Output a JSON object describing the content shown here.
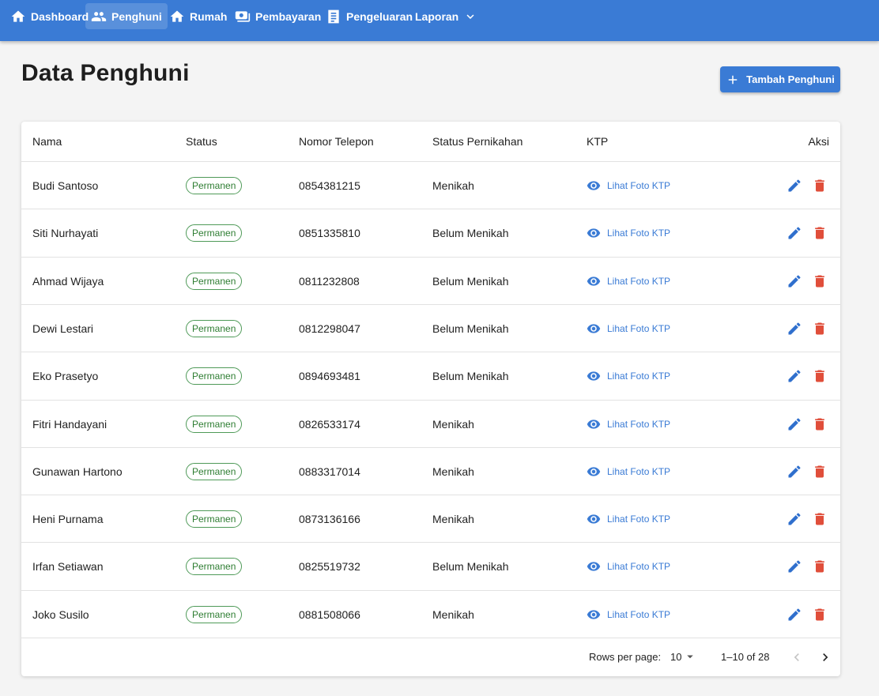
{
  "nav": {
    "items": [
      {
        "label": "Dashboard",
        "icon": "home-icon"
      },
      {
        "label": "Penghuni",
        "icon": "people-icon",
        "active": true
      },
      {
        "label": "Rumah",
        "icon": "home-icon"
      },
      {
        "label": "Pembayaran",
        "icon": "payments-icon"
      },
      {
        "label": "Pengeluaran",
        "icon": "receipt-icon"
      },
      {
        "label": "Laporan",
        "icon": "chevron-down-icon"
      }
    ]
  },
  "page": {
    "title": "Data Penghuni",
    "add_button": "Tambah Penghuni"
  },
  "table": {
    "headers": {
      "name": "Nama",
      "status": "Status",
      "phone": "Nomor Telepon",
      "marital": "Status Pernikahan",
      "ktp": "KTP",
      "actions": "Aksi"
    },
    "ktp_link_label": "Lihat Foto KTP",
    "rows": [
      {
        "name": "Budi Santoso",
        "status": "Permanen",
        "phone": "0854381215",
        "marital": "Menikah"
      },
      {
        "name": "Siti Nurhayati",
        "status": "Permanen",
        "phone": "0851335810",
        "marital": "Belum Menikah"
      },
      {
        "name": "Ahmad Wijaya",
        "status": "Permanen",
        "phone": "0811232808",
        "marital": "Belum Menikah"
      },
      {
        "name": "Dewi Lestari",
        "status": "Permanen",
        "phone": "0812298047",
        "marital": "Belum Menikah"
      },
      {
        "name": "Eko Prasetyo",
        "status": "Permanen",
        "phone": "0894693481",
        "marital": "Belum Menikah"
      },
      {
        "name": "Fitri Handayani",
        "status": "Permanen",
        "phone": "0826533174",
        "marital": "Menikah"
      },
      {
        "name": "Gunawan Hartono",
        "status": "Permanen",
        "phone": "0883317014",
        "marital": "Menikah"
      },
      {
        "name": "Heni Purnama",
        "status": "Permanen",
        "phone": "0873136166",
        "marital": "Menikah"
      },
      {
        "name": "Irfan Setiawan",
        "status": "Permanen",
        "phone": "0825519732",
        "marital": "Belum Menikah"
      },
      {
        "name": "Joko Susilo",
        "status": "Permanen",
        "phone": "0881508066",
        "marital": "Menikah"
      }
    ]
  },
  "pagination": {
    "rows_per_page_label": "Rows per page:",
    "rows_per_page_value": "10",
    "range": "1–10 of 28"
  },
  "colors": {
    "primary": "#3a7bd5",
    "chip_green": "#2e7d32",
    "delete_red": "#e04e3a"
  }
}
